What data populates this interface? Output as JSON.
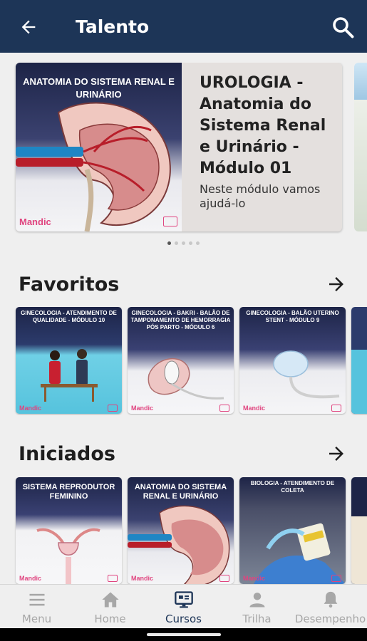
{
  "appbar": {
    "title": "Talento",
    "back_icon": "arrow-left-icon",
    "search_icon": "search-icon",
    "background_color": "#1d3557"
  },
  "carousel": {
    "featured": {
      "thumbnail_caption": "ANATOMIA DO SISTEMA RENAL E URINÁRIO",
      "thumbnail_brand": "Mandic",
      "title": "UROLOGIA - Anatomia do Sistema Renal e Urinário - Módulo 01",
      "description": "Neste módulo vamos ajudá-lo"
    },
    "page_count": 5,
    "active_page": 1
  },
  "favoritos": {
    "title": "Favoritos",
    "arrow_icon": "arrow-right-icon",
    "cards": [
      {
        "caption": "GINECOLOGIA - ATENDIMENTO DE QUALIDADE - MÓDULO 10",
        "brand": "Mandic"
      },
      {
        "caption": "GINECOLOGIA - BAKRI - BALÃO DE TAMPONAMENTO DE HEMORRAGIA PÓS PARTO - MÓDULO 6",
        "brand": "Mandic"
      },
      {
        "caption": "GINECOLOGIA - BALÃO UTERINO STENT - MÓDULO 9",
        "brand": "Mandic"
      }
    ]
  },
  "iniciados": {
    "title": "Iniciados",
    "arrow_icon": "arrow-right-icon",
    "cards": [
      {
        "caption": "SISTEMA REPRODUTOR FEMININO",
        "brand": "Mandic"
      },
      {
        "caption": "ANATOMIA DO SISTEMA RENAL E URINÁRIO",
        "brand": "Mandic"
      },
      {
        "caption": "BIOLOGIA - ATENDIMENTO DE COLETA",
        "brand": "Mandic"
      }
    ]
  },
  "bottom_nav": {
    "items": [
      {
        "label": "Menu",
        "icon": "menu-icon",
        "active": false
      },
      {
        "label": "Home",
        "icon": "home-icon",
        "active": false
      },
      {
        "label": "Cursos",
        "icon": "courses-icon",
        "active": true
      },
      {
        "label": "Trilha",
        "icon": "person-icon",
        "active": false
      },
      {
        "label": "Desempenho",
        "icon": "bell-icon",
        "active": false
      }
    ],
    "active_color": "#1d3557",
    "inactive_color": "#a7a7a7"
  }
}
